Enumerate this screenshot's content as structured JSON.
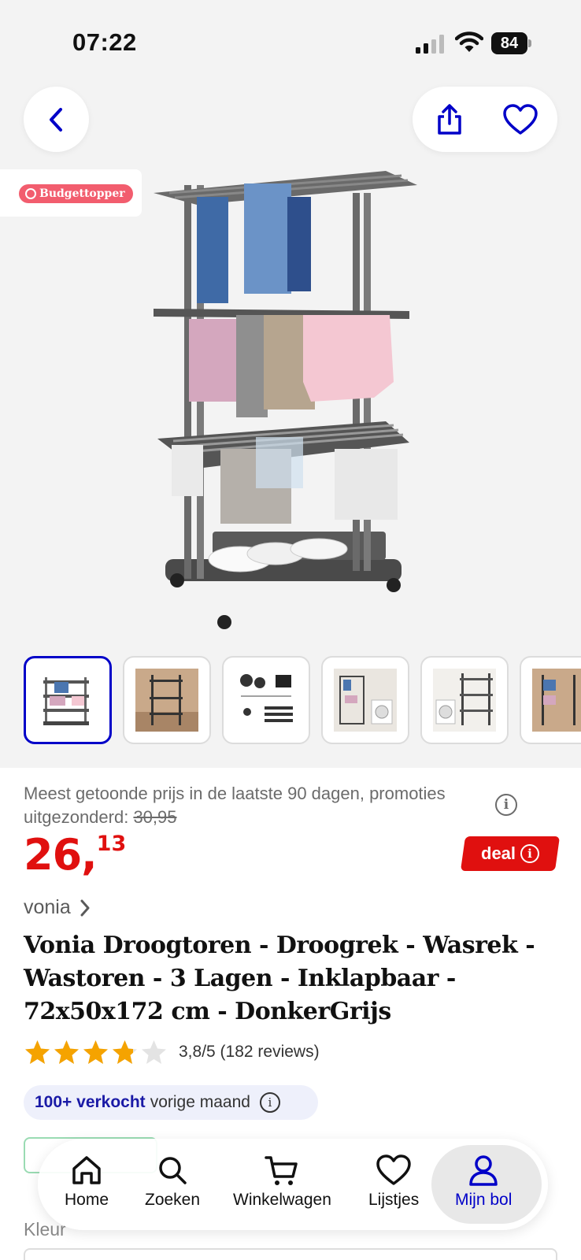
{
  "status_bar": {
    "time": "07:22",
    "battery": "84"
  },
  "badge": {
    "label": "Budgettopper"
  },
  "price": {
    "note_prefix": "Meest getoonde prijs in de laatste 90 dagen, promoties uitgezonderd: ",
    "old_price": "30,95",
    "euros": "26,",
    "cents": "13",
    "deal_label": "deal",
    "accent_color": "#e0100f"
  },
  "product": {
    "brand": "vonia",
    "title": "Vonia Droogtoren - Droogrek - Wasrek - Wastoren - 3 Lagen - Inklapbaar - 72x50x172 cm - DonkerGrijs",
    "rating_value": 3.8,
    "rating_max": 5,
    "rating_text": "3,8/5 (182 reviews)",
    "sold_bold": "100+ verkocht",
    "sold_rest": "vorige maand"
  },
  "partial": {
    "color_label": "Kleur"
  },
  "thumbnails": [
    {
      "name": "thumb-1",
      "selected": true
    },
    {
      "name": "thumb-2",
      "selected": false
    },
    {
      "name": "thumb-3",
      "selected": false
    },
    {
      "name": "thumb-4",
      "selected": false
    },
    {
      "name": "thumb-5",
      "selected": false
    },
    {
      "name": "thumb-6",
      "selected": false
    }
  ],
  "nav": {
    "items": [
      {
        "label": "Home",
        "icon": "home-icon"
      },
      {
        "label": "Zoeken",
        "icon": "search-icon"
      },
      {
        "label": "Winkelwagen",
        "icon": "cart-icon"
      },
      {
        "label": "Lijstjes",
        "icon": "heart-icon"
      },
      {
        "label": "Mijn bol",
        "icon": "user-icon"
      }
    ],
    "active_color": "#0000c8"
  }
}
